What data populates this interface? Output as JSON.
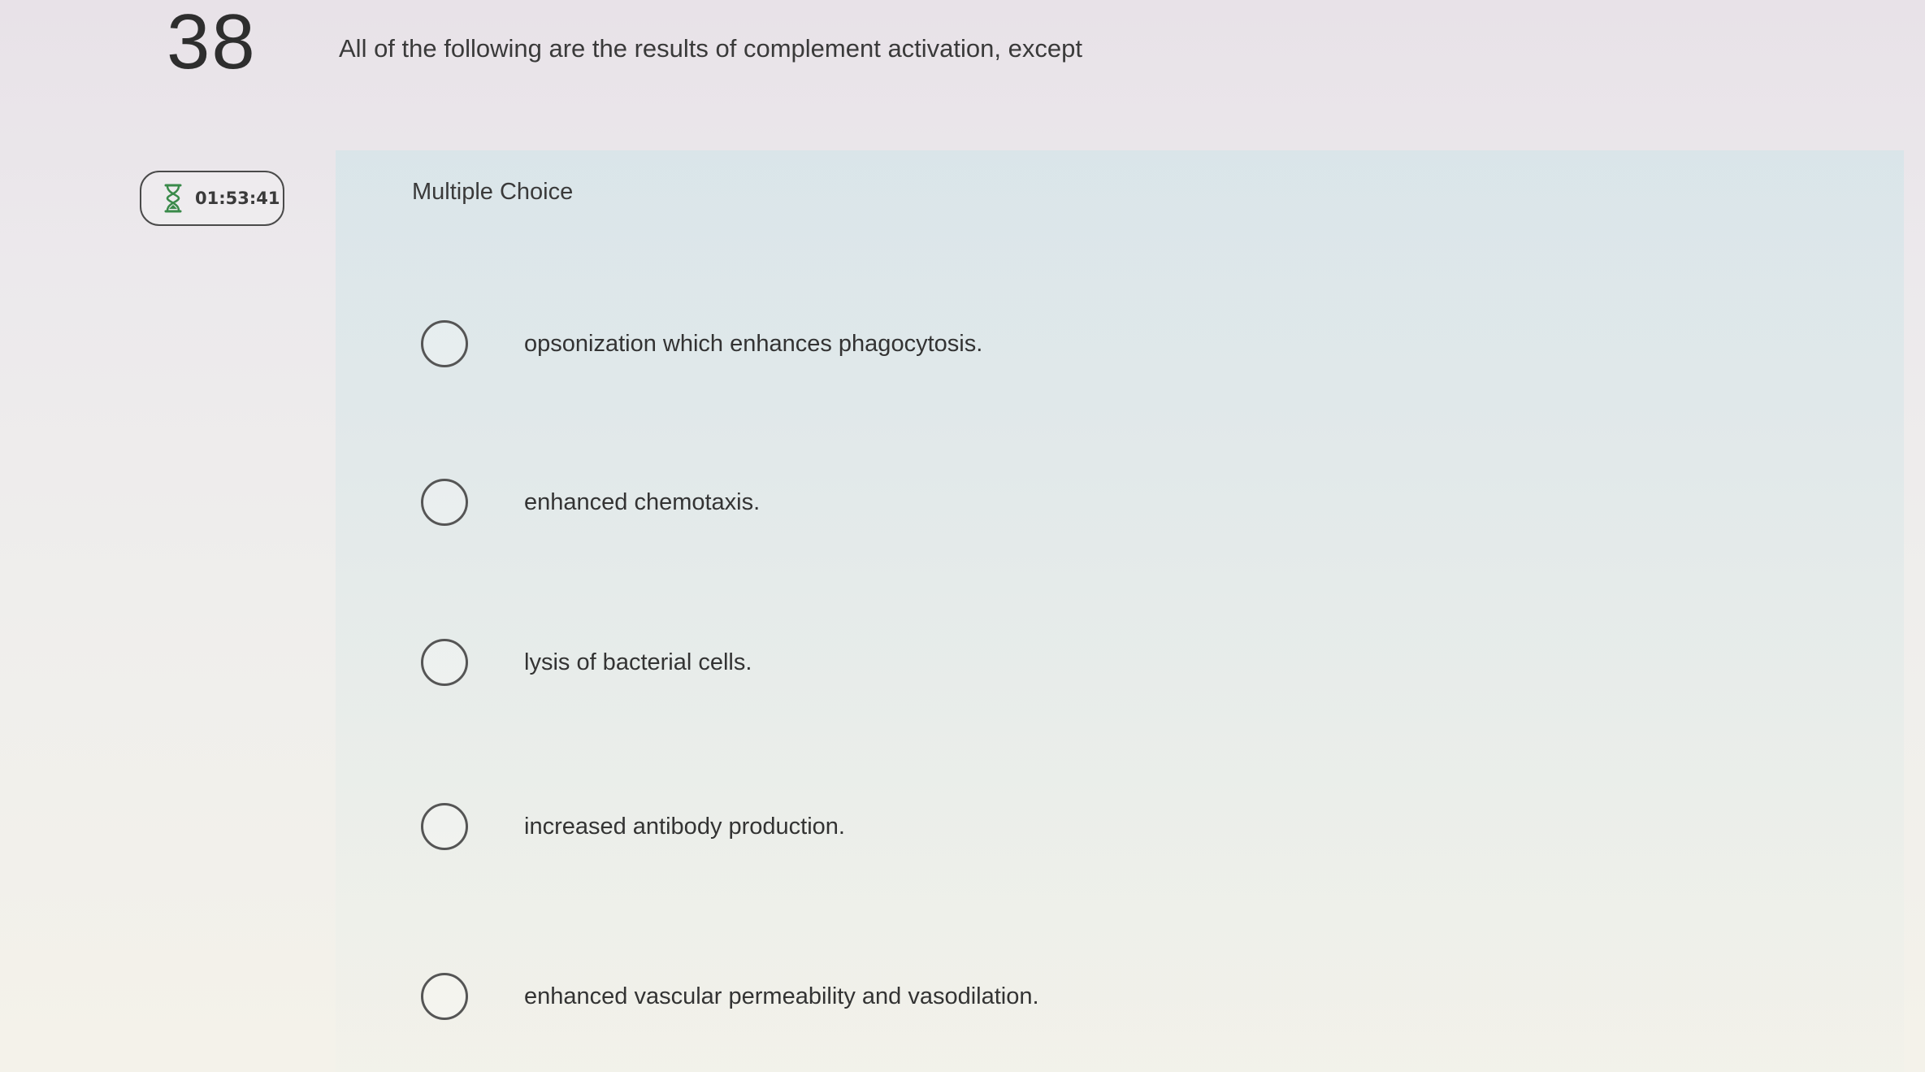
{
  "question": {
    "number": "38",
    "prompt": "All of the following are the results of complement activation, except"
  },
  "timer": {
    "icon": "hourglass-icon",
    "time": "01:53:41"
  },
  "answer_area": {
    "type_label": "Multiple Choice",
    "options": [
      {
        "label": "opsonization which enhances phagocytosis.",
        "selected": false
      },
      {
        "label": "enhanced chemotaxis.",
        "selected": false
      },
      {
        "label": "lysis of bacterial cells.",
        "selected": false
      },
      {
        "label": "increased antibody production.",
        "selected": false
      },
      {
        "label": "enhanced vascular permeability and vasodilation.",
        "selected": false
      }
    ]
  }
}
